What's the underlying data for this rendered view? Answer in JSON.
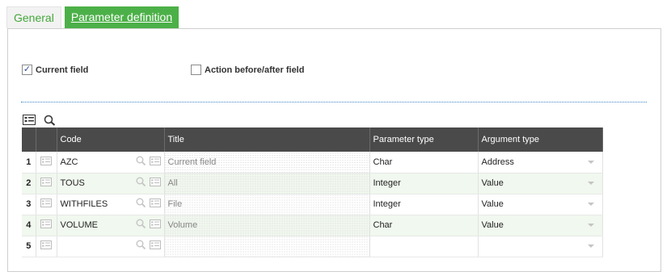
{
  "tabs": [
    {
      "label": "General",
      "active": false
    },
    {
      "label": "Parameter definition",
      "active": true
    }
  ],
  "checkboxes": {
    "current_field": {
      "label": "Current field",
      "checked": true
    },
    "action_before_after": {
      "label": "Action before/after field",
      "checked": false
    }
  },
  "grid": {
    "columns": [
      "",
      "",
      "Code",
      "Title",
      "Parameter type",
      "Argument type"
    ],
    "rows": [
      {
        "num": "1",
        "code": "AZC",
        "title": "Current field",
        "param_type": "Char",
        "arg_type": "Address"
      },
      {
        "num": "2",
        "code": "TOUS",
        "title": "All",
        "param_type": "Integer",
        "arg_type": "Value"
      },
      {
        "num": "3",
        "code": "WITHFILES",
        "title": "File",
        "param_type": "Integer",
        "arg_type": "Value"
      },
      {
        "num": "4",
        "code": "VOLUME",
        "title": "Volume",
        "param_type": "Char",
        "arg_type": "Value"
      },
      {
        "num": "5",
        "code": "",
        "title": "",
        "param_type": "",
        "arg_type": ""
      }
    ]
  },
  "icons": {
    "grid_toolbar": [
      "list-icon",
      "search-icon"
    ],
    "row_detail": "detail-icon",
    "lookup": "search-icon",
    "select_caret": "chevron-down-icon"
  },
  "colors": {
    "accent": "#4cb048",
    "header_bg": "#4a4a4a",
    "row_even_bg": "#f1f8ef",
    "divider": "#3a86c8"
  }
}
